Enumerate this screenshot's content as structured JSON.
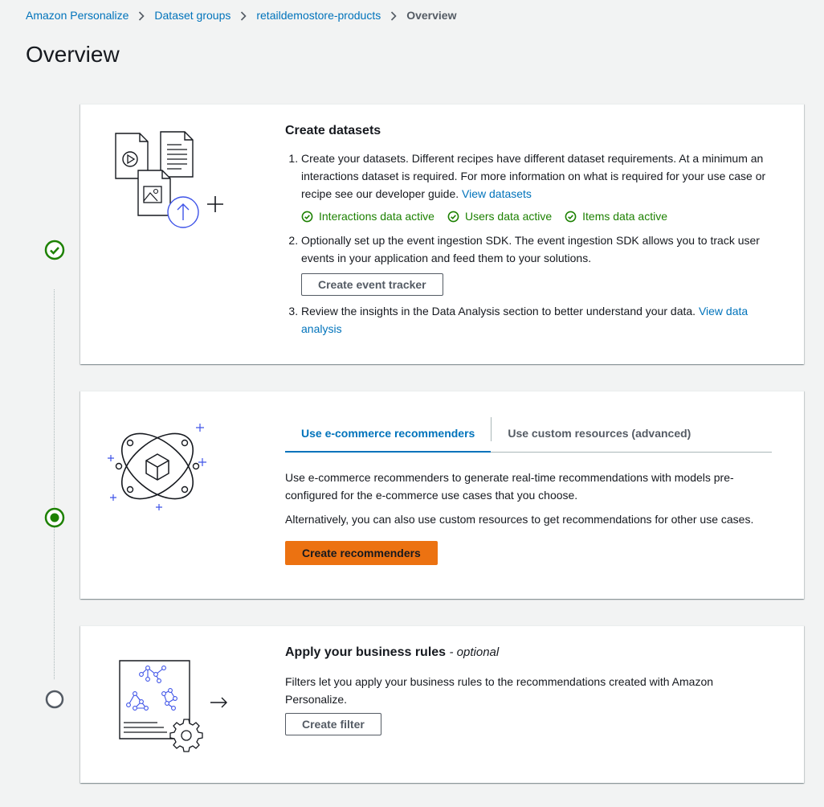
{
  "breadcrumb": {
    "items": [
      "Amazon Personalize",
      "Dataset groups",
      "retaildemostore-products"
    ],
    "current": "Overview"
  },
  "page_title": "Overview",
  "steps": {
    "datasets": {
      "title": "Create datasets",
      "item1_text": "Create your datasets. Different recipes have different dataset requirements. At a minimum an interactions dataset is required. For more information on what is required for your use case or recipe see our developer guide.",
      "item1_link": "View datasets",
      "statuses": [
        "Interactions data active",
        "Users data active",
        "Items data active"
      ],
      "item2_text": "Optionally set up the event ingestion SDK. The event ingestion SDK allows you to track user events in your application and feed them to your solutions.",
      "event_tracker_button": "Create event tracker",
      "item3_text": "Review the insights in the Data Analysis section to better understand your data.",
      "item3_link": "View data analysis"
    },
    "recommenders": {
      "tabs": [
        "Use e-commerce recommenders",
        "Use custom resources (advanced)"
      ],
      "text1": "Use e-commerce recommenders to generate real-time recommendations with models pre-configured for the e-commerce use cases that you choose.",
      "text2": "Alternatively, you can also use custom resources to get recommendations for other use cases.",
      "button": "Create recommenders"
    },
    "filters": {
      "title": "Apply your business rules",
      "title_suffix": "- optional",
      "text": "Filters let you apply your business rules to the recommendations created with Amazon Personalize.",
      "button": "Create filter"
    }
  },
  "icons": {
    "step1": "check-circle-icon",
    "step2": "in-progress-circle-icon",
    "step3": "empty-circle-icon"
  },
  "colors": {
    "accent": "#0073bb",
    "success": "#1d8102",
    "primary_button": "#ec7211"
  }
}
